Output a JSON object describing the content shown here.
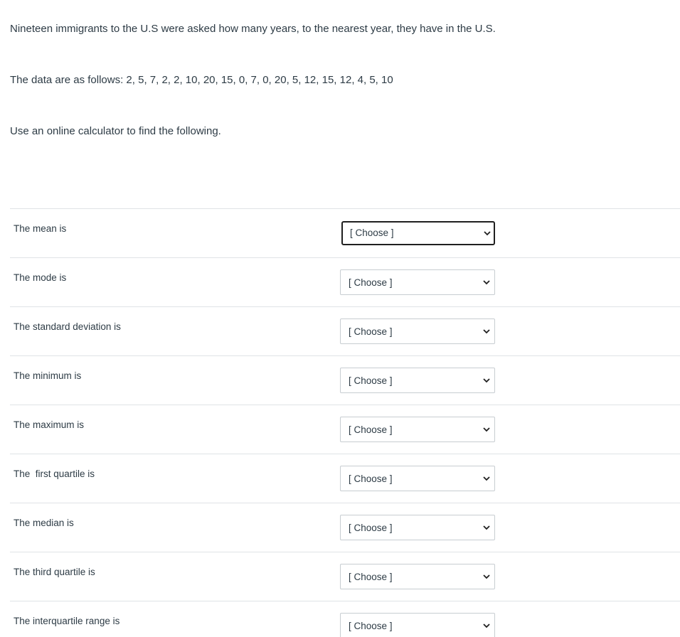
{
  "question": {
    "intro": "Nineteen immigrants to the U.S were asked how many years, to the nearest year, they have  in the U.S.",
    "data_line": "The data are as follows: 2,  5,  7,  2,  2,  10,  20,  15,  0,  7,  0,  20,  5,  12,  15,  12,  4,  5,  10",
    "instruction": "Use an online calculator to find the following."
  },
  "answers": [
    {
      "label": "The mean is",
      "selected": "[ Choose ]"
    },
    {
      "label": "The mode is",
      "selected": "[ Choose ]"
    },
    {
      "label": "The standard deviation is",
      "selected": "[ Choose ]"
    },
    {
      "label": "The minimum is",
      "selected": "[ Choose ]"
    },
    {
      "label": "The maximum is",
      "selected": "[ Choose ]"
    },
    {
      "label": "The  first quartile is",
      "selected": "[ Choose ]"
    },
    {
      "label": "The median is",
      "selected": "[ Choose ]"
    },
    {
      "label": "The third quartile is",
      "selected": "[ Choose ]"
    },
    {
      "label": "The interquartile range is",
      "selected": "[ Choose ]"
    }
  ],
  "icons": {
    "dropdown": "chevron-down-icon"
  },
  "colors": {
    "text": "#2d3b45",
    "divider": "#dfe3e6",
    "select_border": "#c7cdd1",
    "focus_border": "#1f1f1f"
  }
}
